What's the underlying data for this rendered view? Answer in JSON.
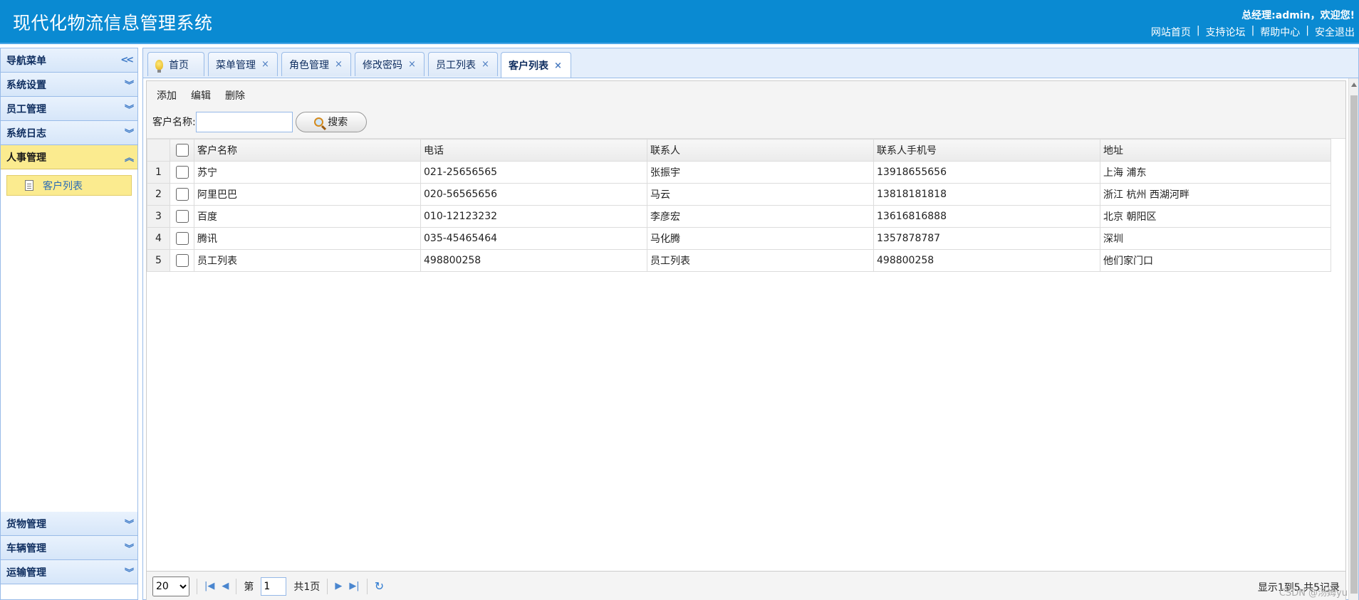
{
  "header": {
    "title": "现代化物流信息管理系统",
    "welcome": "总经理:admin，欢迎您!",
    "links": [
      "网站首页",
      "支持论坛",
      "帮助中心",
      "安全退出"
    ],
    "link_separator": "|"
  },
  "sidebar": {
    "top": [
      {
        "label": "导航菜单",
        "icon": "double-chevron-left-icon"
      },
      {
        "label": "系统设置",
        "icon": "double-chevron-down-icon"
      },
      {
        "label": "员工管理",
        "icon": "double-chevron-down-icon"
      },
      {
        "label": "系统日志",
        "icon": "double-chevron-down-icon"
      },
      {
        "label": "人事管理",
        "icon": "double-chevron-up-icon",
        "active": true
      }
    ],
    "active_item": {
      "label": "客户列表",
      "icon": "document-icon"
    },
    "bottom": [
      {
        "label": "货物管理",
        "icon": "double-chevron-down-icon"
      },
      {
        "label": "车辆管理",
        "icon": "double-chevron-down-icon"
      },
      {
        "label": "运输管理",
        "icon": "double-chevron-down-icon"
      }
    ]
  },
  "tabs": [
    {
      "label": "首页",
      "icon": "lightbulb-icon",
      "closable": false
    },
    {
      "label": "菜单管理",
      "closable": true
    },
    {
      "label": "角色管理",
      "closable": true
    },
    {
      "label": "修改密码",
      "closable": true
    },
    {
      "label": "员工列表",
      "closable": true
    },
    {
      "label": "客户列表",
      "closable": true,
      "active": true
    }
  ],
  "close_glyph": "×",
  "toolbar": {
    "add": "添加",
    "edit": "编辑",
    "delete": "删除"
  },
  "search": {
    "label": "客户名称:",
    "value": "",
    "button": "搜索"
  },
  "table": {
    "columns": [
      "客户名称",
      "电话",
      "联系人",
      "联系人手机号",
      "地址"
    ],
    "rows": [
      {
        "num": "1",
        "name": "苏宁",
        "phone": "021-25656565",
        "contact": "张振宇",
        "mobile": "13918655656",
        "address": "上海 浦东"
      },
      {
        "num": "2",
        "name": "阿里巴巴",
        "phone": "020-56565656",
        "contact": "马云",
        "mobile": "13818181818",
        "address": "浙江 杭州 西湖河畔"
      },
      {
        "num": "3",
        "name": "百度",
        "phone": "010-12123232",
        "contact": "李彦宏",
        "mobile": "13616816888",
        "address": "北京 朝阳区"
      },
      {
        "num": "4",
        "name": "腾讯",
        "phone": "035-45465464",
        "contact": "马化腾",
        "mobile": "1357878787",
        "address": "深圳"
      },
      {
        "num": "5",
        "name": "员工列表",
        "phone": "498800258",
        "contact": "员工列表",
        "mobile": "498800258",
        "address": "他们家门口"
      }
    ]
  },
  "pager": {
    "page_size": "20",
    "page_prefix": "第",
    "page_value": "1",
    "page_total": "共1页",
    "info": "显示1到5,共5记录"
  },
  "watermark": "CSDN @汤姆yu",
  "colors": {
    "header_bg": "#0a8ad2",
    "active_bg": "#fbeb8f",
    "border": "#99bbe8"
  }
}
